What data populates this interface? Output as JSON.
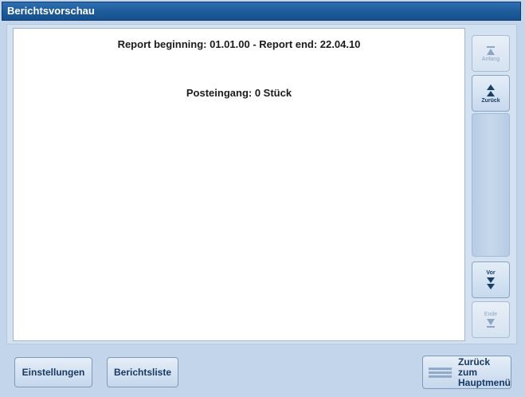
{
  "window": {
    "title": "Berichtsvorschau"
  },
  "report": {
    "range_line": "Report beginning: 01.01.00 - Report end: 22.04.10",
    "inbox_line": "Posteingang: 0 Stück"
  },
  "scrollbar": {
    "first_label": "Anfang",
    "prev_label": "Zurück",
    "next_label": "Vor",
    "last_label": "Ende"
  },
  "footer": {
    "settings_label": "Einstellungen",
    "report_list_label": "Berichtsliste",
    "back_label_line1": "Zurück zum",
    "back_label_line2": "Hauptmenü"
  }
}
